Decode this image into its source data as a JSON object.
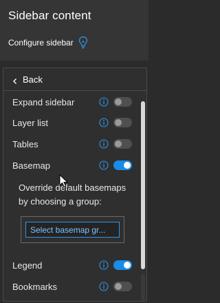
{
  "header": {
    "title": "Sidebar content",
    "configure_label": "Configure sidebar"
  },
  "panel": {
    "back_label": "Back",
    "rows": [
      {
        "label": "Expand sidebar",
        "toggle": "off"
      },
      {
        "label": "Layer list",
        "toggle": "off"
      },
      {
        "label": "Tables",
        "toggle": "off"
      },
      {
        "label": "Basemap",
        "toggle": "on"
      },
      {
        "label": "Legend",
        "toggle": "on"
      },
      {
        "label": "Bookmarks",
        "toggle": "off"
      }
    ],
    "basemap_override_text": "Override default basemaps by choosing a group:",
    "select_basemap_label": "Select basemap gr..."
  },
  "colors": {
    "accent": "#1a8be6",
    "panel_bg": "#2f2f2f",
    "header_bg": "#353535"
  },
  "icons": [
    "lightbulb-icon",
    "chevron-left-icon",
    "info-icon",
    "cursor-arrow-icon"
  ]
}
